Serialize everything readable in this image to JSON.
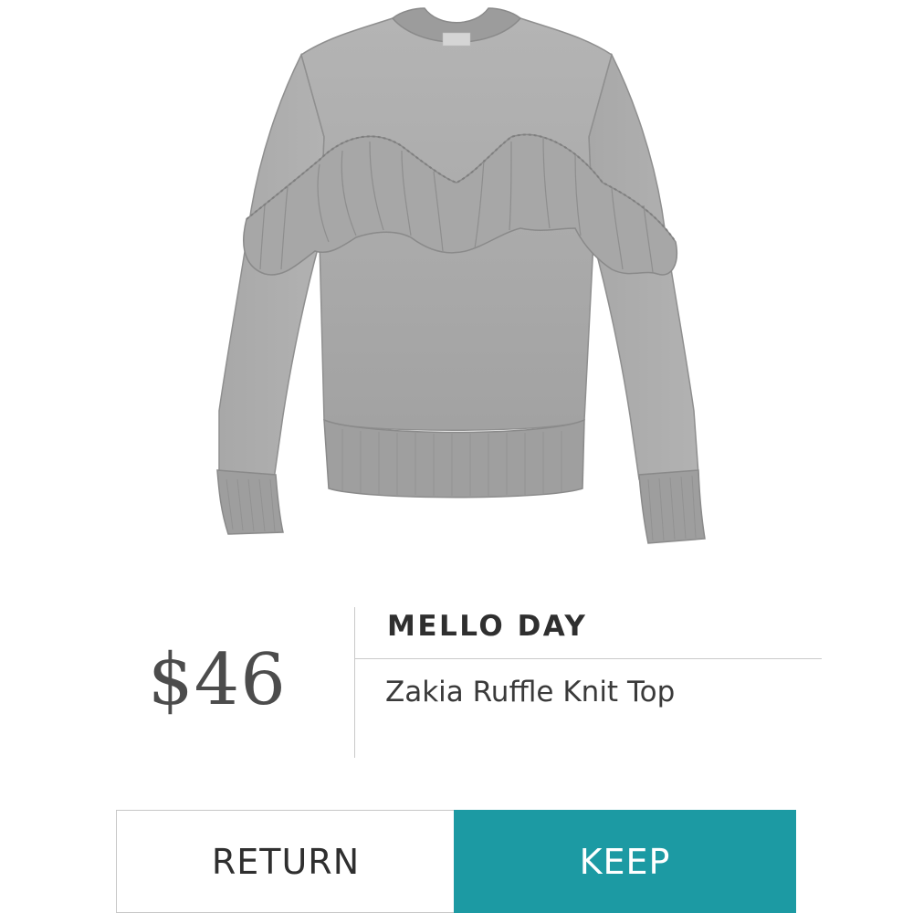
{
  "product": {
    "price": "$46",
    "brand": "MELLO DAY",
    "name": "Zakia Ruffle Knit Top",
    "image_icon": "gray-ruffle-sweatshirt"
  },
  "actions": {
    "return_label": "RETURN",
    "keep_label": "KEEP"
  },
  "colors": {
    "keep_button_bg": "#1c9aa3",
    "price_text": "#4c4c4c",
    "garment_gray": "#a9a9a9"
  }
}
